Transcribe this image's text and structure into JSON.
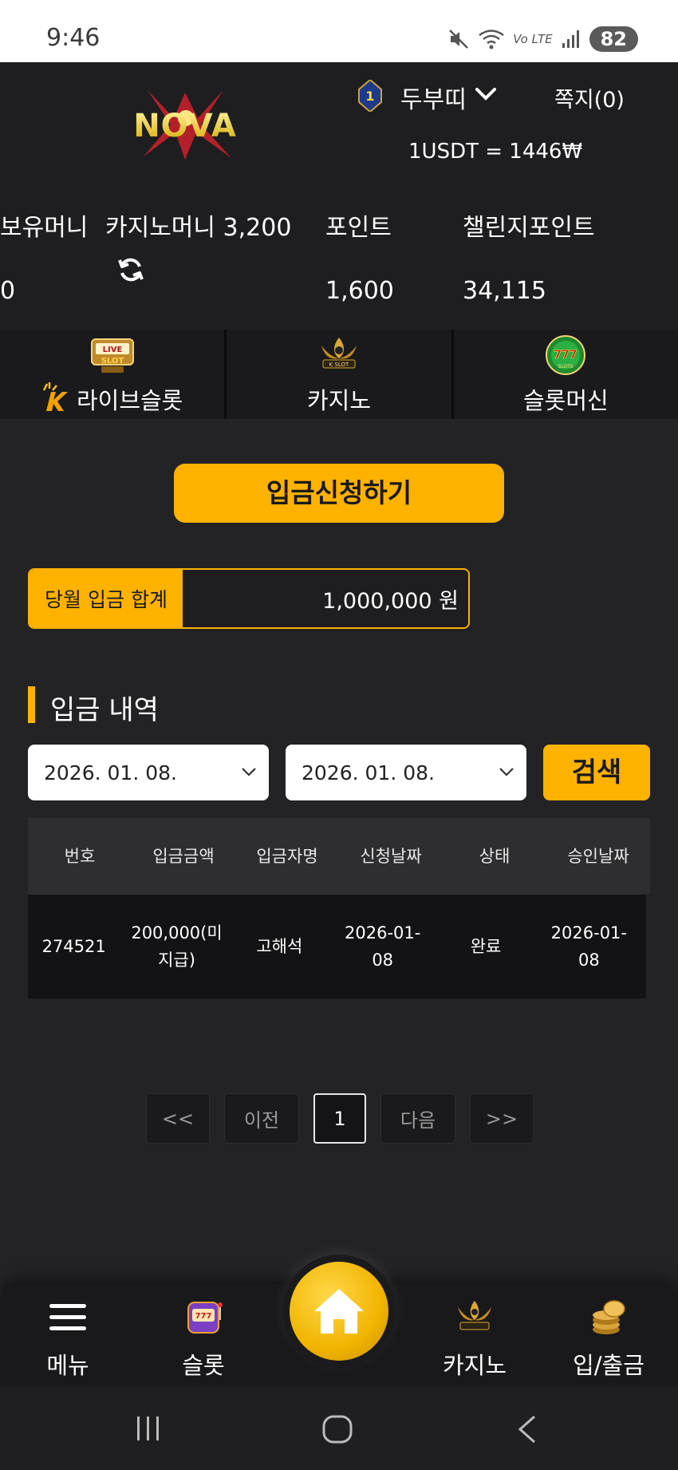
{
  "status_bar": {
    "time": "9:46",
    "battery": "82",
    "network": "Vo LTE"
  },
  "header": {
    "logo_text": "NOVA",
    "rank": "1",
    "username": "두부띠",
    "messages": "쪽지(0)",
    "rate": "1USDT = 1446₩"
  },
  "stats": {
    "money_label": "보유머니",
    "money_value": "0",
    "casino_label": "카지노머니 3,200",
    "point_label": "포인트",
    "point_value": "1,600",
    "challenge_label": "챌린지포인트",
    "challenge_value": "34,115"
  },
  "categories": [
    {
      "label": "라이브슬롯",
      "icon": "live-slot-icon",
      "badge_text": "LIVE SLOT"
    },
    {
      "label": "카지노",
      "icon": "k-slot-icon",
      "badge_text": "K SLOT"
    },
    {
      "label": "슬롯머신",
      "icon": "777-slots-icon",
      "badge_text": "777"
    }
  ],
  "deposit_button": "입금신청하기",
  "monthly": {
    "label": "당월 입금 합계",
    "value": "1,000,000 원"
  },
  "section_title": "입금 내역",
  "filters": {
    "date_from": "2026. 01. 08.",
    "date_to": "2026. 01. 08.",
    "search": "검색"
  },
  "table": {
    "headers": [
      "번호",
      "입금금액",
      "입금자명",
      "신청날짜",
      "상태",
      "승인날짜"
    ],
    "rows": [
      [
        "274521",
        "200,000(미지급)",
        "고해석",
        "2026-01-08",
        "완료",
        "2026-01-08"
      ]
    ]
  },
  "pagination": {
    "first": "<<",
    "prev": "이전",
    "current": "1",
    "next": "다음",
    "last": ">>"
  },
  "bottom_nav": {
    "menu": "메뉴",
    "slot": "슬롯",
    "casino": "카지노",
    "deposit": "입/출금"
  },
  "colors": {
    "accent": "#fdb200",
    "background": "#232325",
    "header_bg": "#1e1e20"
  }
}
